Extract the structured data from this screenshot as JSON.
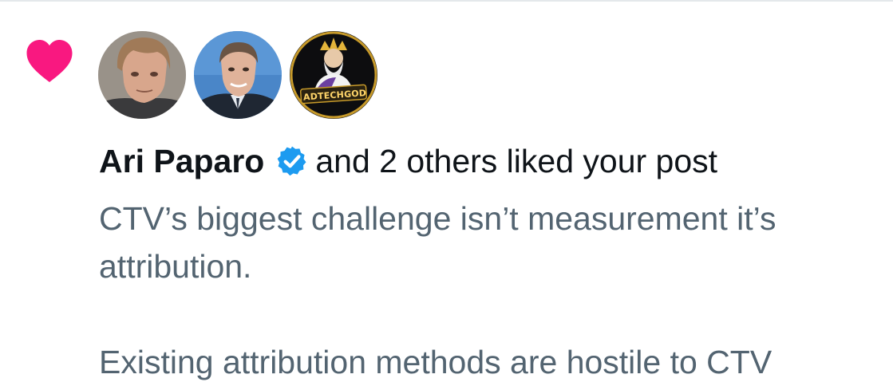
{
  "notification": {
    "type_icon": "heart-icon",
    "accent_color": "#f91880",
    "liker_name": "Ari Paparo",
    "verified_icon": "verified-badge-icon",
    "verified_color": "#1d9bf0",
    "action_text": "and 2 others liked your post",
    "avatars": [
      {
        "name": "avatar-ari-paparo",
        "label": ""
      },
      {
        "name": "avatar-second-liker",
        "label": ""
      },
      {
        "name": "avatar-adtechgod",
        "label": "ADTECHGOD"
      }
    ],
    "post_lines": [
      "CTV’s biggest challenge isn’t measurement it’s",
      "attribution.",
      "",
      "Existing attribution methods are hostile to CTV"
    ]
  }
}
